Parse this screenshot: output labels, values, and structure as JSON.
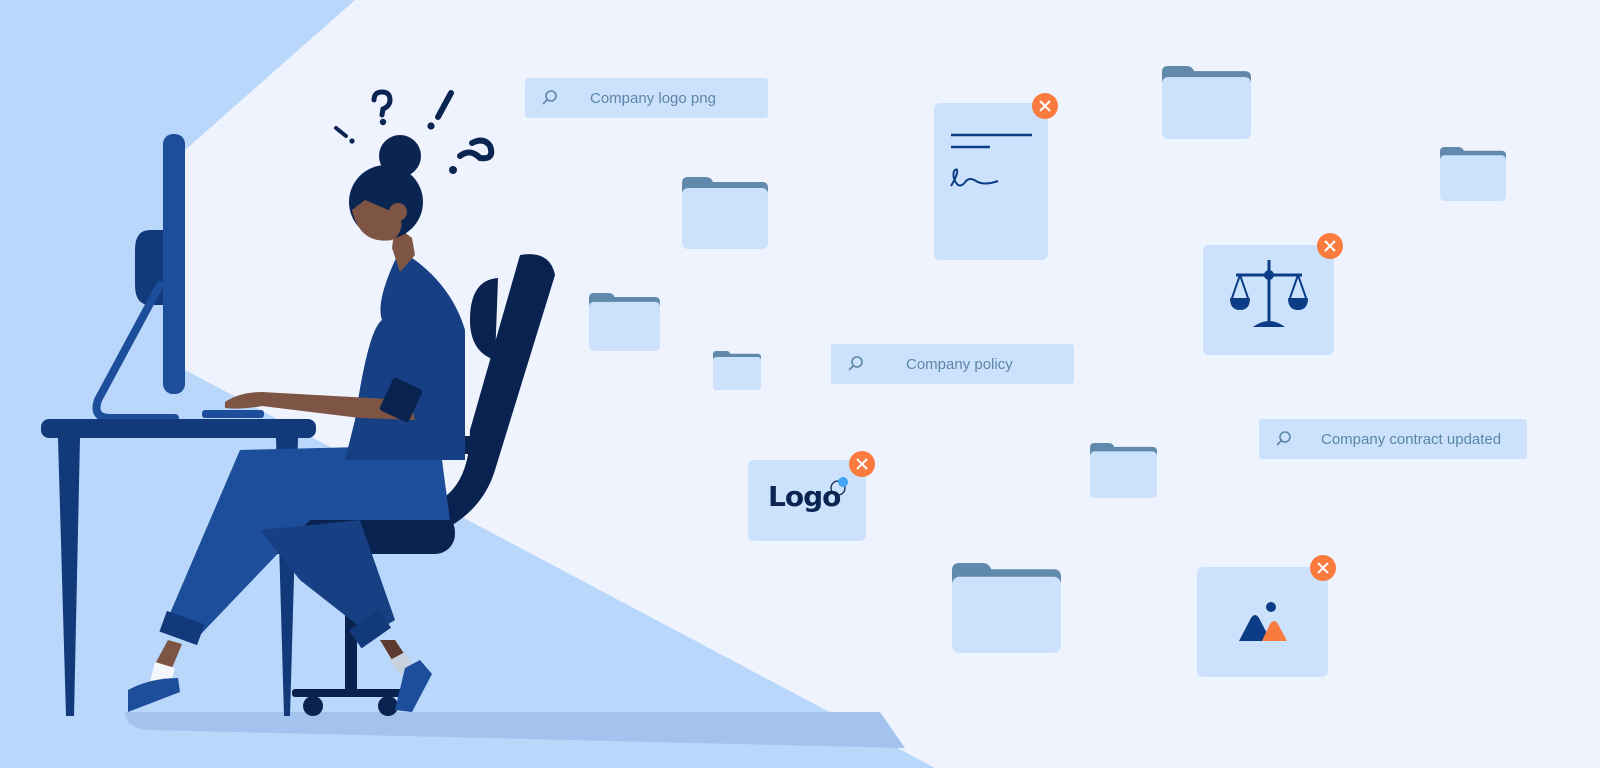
{
  "scene": {
    "description": "Confused person at desk searching for company files",
    "colors": {
      "background_light": "#eef3fd",
      "background_blue": "#b8d7fb",
      "card_fill": "#cce2fc",
      "navy": "#0b2553",
      "accent_orange": "#fb7a3e",
      "folder_tab": "#6189ab",
      "search_text": "#5b86aa"
    }
  },
  "search_bars": [
    {
      "query": "Company logo png",
      "icon": "search-icon"
    },
    {
      "query": "Company policy",
      "icon": "search-icon"
    },
    {
      "query": "Company contract updated",
      "icon": "search-icon"
    }
  ],
  "cards": {
    "document": {
      "icon": "signed-document-icon",
      "close_icon": "close-icon"
    },
    "legal": {
      "icon": "scales-of-justice-icon",
      "close_icon": "close-icon"
    },
    "logo": {
      "label": "Logo",
      "close_icon": "close-icon"
    },
    "image": {
      "icon": "image-icon",
      "close_icon": "close-icon"
    }
  },
  "thought_symbols": [
    "!",
    "?",
    "!",
    "?"
  ]
}
